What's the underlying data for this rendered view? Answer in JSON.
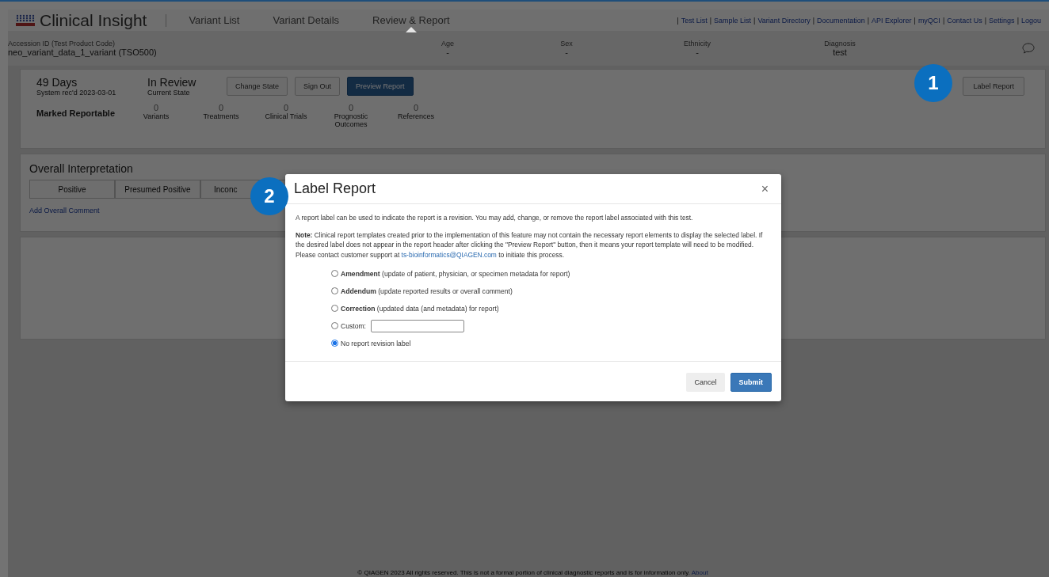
{
  "nav": {
    "logo": "Clinical Insight",
    "tabs": [
      {
        "label": "Variant List",
        "selected": false
      },
      {
        "label": "Variant Details",
        "selected": false
      },
      {
        "label": "Review & Report",
        "selected": true
      }
    ],
    "separator": "|",
    "links": [
      "Test List",
      "Sample List",
      "Variant Directory",
      "Documentation",
      "API Explorer",
      "myQCI",
      "Contact Us",
      "Settings",
      "Logou"
    ]
  },
  "patient": {
    "fields": [
      {
        "label": "Accession ID (Test Product Code)",
        "value": "neo_variant_data_1_variant  (TSO500)"
      },
      {
        "label": "Age",
        "value": "-"
      },
      {
        "label": "Sex",
        "value": "-"
      },
      {
        "label": "Ethnicity",
        "value": "-"
      },
      {
        "label": "Diagnosis",
        "value": "test"
      }
    ]
  },
  "status": {
    "days": "49 Days",
    "received": "System rec'd 2023-03-01",
    "state": "In Review",
    "state_label": "Current State",
    "buttons": [
      {
        "label": "Change State",
        "primary": false
      },
      {
        "label": "Sign Out",
        "primary": false
      },
      {
        "label": "Preview Report",
        "primary": true
      }
    ],
    "label_button": "Label Report",
    "reportable_title": "Marked Reportable",
    "counts": [
      {
        "value": "0",
        "label": "Variants"
      },
      {
        "value": "0",
        "label": "Treatments"
      },
      {
        "value": "0",
        "label": "Clinical Trials"
      },
      {
        "value": "0",
        "label": "Prognostic Outcomes"
      },
      {
        "value": "0",
        "label": "References"
      }
    ]
  },
  "interpretation": {
    "title": "Overall Interpretation",
    "options": [
      "Positive",
      "Presumed Positive",
      "Inconc"
    ],
    "comment_link": "Add Overall Comment"
  },
  "footer": {
    "text": "© QIAGEN 2023 All rights reserved. This is not a formal portion of clinical diagnostic reports and is for information only.",
    "link": "About"
  },
  "callouts": [
    "1",
    "2"
  ],
  "dialog": {
    "title": "Label Report",
    "close": "×",
    "intro": "A report label can be used to indicate the report is a revision. You may add, change, or remove the report label associated with this test.",
    "note": "**Note:** Clinical report templates created prior to the implementation of this feature may not contain the necessary report elements to display the selected label. If the desired label does not appear in the report header after clicking the \"Preview Report\" button, then it means your report template will need to be modified. Please contact customer support at",
    "email": "ts-bioinformatics@QIAGEN.com",
    "note_end": "to initiate this process.",
    "options": [
      {
        "kind": "text",
        "label": "**Amendment** (update of patient, physician, or specimen metadata for report)",
        "selected": false
      },
      {
        "kind": "text",
        "label": "**Addendum** (update reported results or overall comment)",
        "selected": false
      },
      {
        "kind": "text",
        "label": "**Correction** (updated data (and metadata) for report)",
        "selected": false
      },
      {
        "kind": "custom",
        "label": "Custom:",
        "selected": false
      },
      {
        "kind": "text",
        "label": "No report revision label",
        "selected": true
      }
    ],
    "cancel": "Cancel",
    "submit": "Submit"
  }
}
